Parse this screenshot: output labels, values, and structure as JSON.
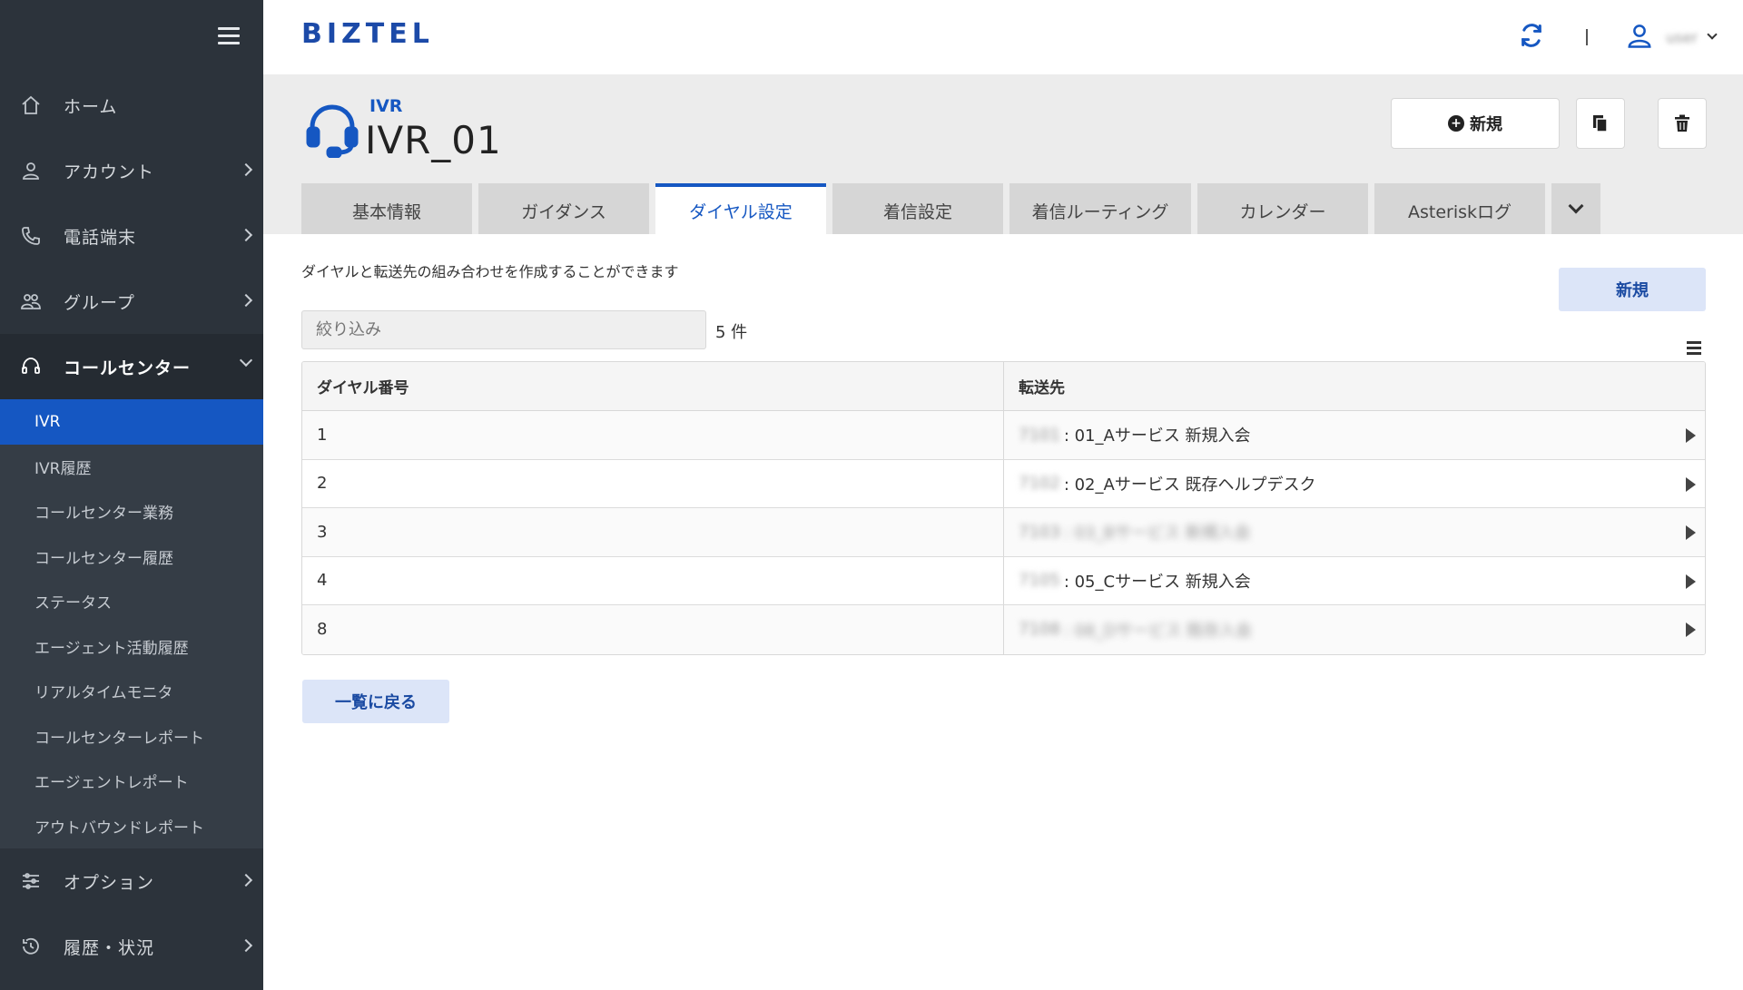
{
  "sidebar": {
    "nav": [
      {
        "label": "ホーム",
        "icon": "home-icon"
      },
      {
        "label": "アカウント",
        "icon": "user-icon"
      },
      {
        "label": "電話端末",
        "icon": "phone-icon"
      },
      {
        "label": "グループ",
        "icon": "group-icon"
      },
      {
        "label": "コールセンター",
        "icon": "headset-icon"
      }
    ],
    "sub_items": [
      "IVR",
      "IVR履歴",
      "コールセンター業務",
      "コールセンター履歴",
      "ステータス",
      "エージェント活動履歴",
      "リアルタイムモニタ",
      "コールセンターレポート",
      "エージェントレポート",
      "アウトバウンドレポート"
    ],
    "nav_bottom": [
      {
        "label": "オプション",
        "icon": "sliders-icon"
      },
      {
        "label": "履歴・状況",
        "icon": "history-icon"
      }
    ]
  },
  "header": {
    "logo": "BIZTEL",
    "user_name": "user"
  },
  "page": {
    "crumb": "IVR",
    "title": "IVR_01",
    "new_button": "新規"
  },
  "tabs": [
    "基本情報",
    "ガイダンス",
    "ダイヤル設定",
    "着信設定",
    "着信ルーティング",
    "カレンダー",
    "Asteriskログ"
  ],
  "content": {
    "description": "ダイヤルと転送先の組み合わせを作成することができます",
    "new_button": "新規",
    "filter_placeholder": "絞り込み",
    "count": "5 件",
    "columns": [
      "ダイヤル番号",
      "転送先"
    ],
    "rows": [
      {
        "dial": "1",
        "dest_prefix": "7101",
        "dest": ": 01_Aサービス 新規入会"
      },
      {
        "dial": "2",
        "dest_prefix": "7102",
        "dest": ": 02_Aサービス 既存ヘルプデスク"
      },
      {
        "dial": "3",
        "dest_prefix": "7103",
        "dest": ": 03_Bサービス 新規入会"
      },
      {
        "dial": "4",
        "dest_prefix": "7105",
        "dest": ": 05_Cサービス 新規入会"
      },
      {
        "dial": "8",
        "dest_prefix": "7108",
        "dest": ": 08_Dサービス 既存入会"
      }
    ],
    "back_button": "一覧に戻る"
  },
  "colors": {
    "sidebar_bg": "#2c333b",
    "active": "#1557c2",
    "brand": "#1c4aa8",
    "soft_button": "#dce5f8"
  }
}
